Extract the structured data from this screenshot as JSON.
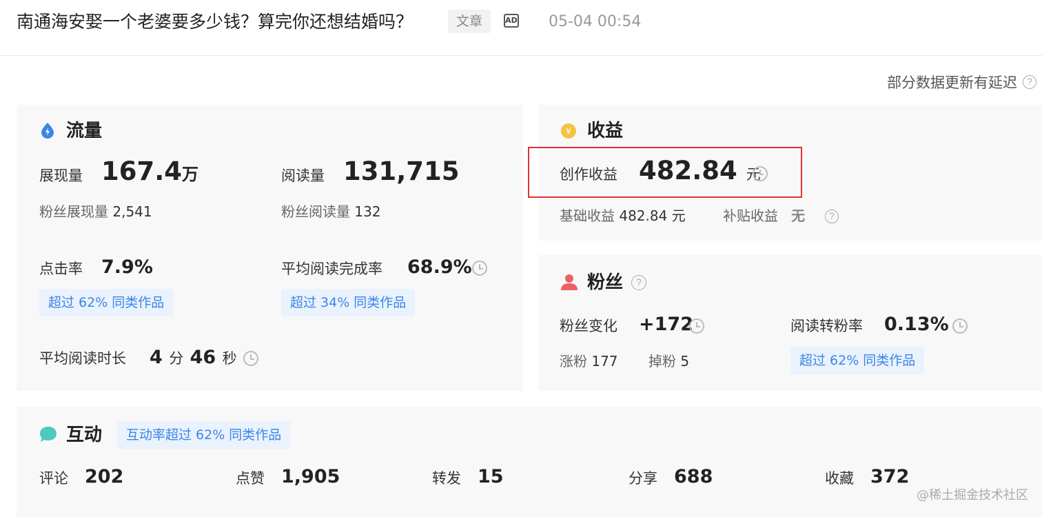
{
  "header": {
    "title": "南通海安娶一个老婆要多少钱？算完你还想结婚吗？",
    "type_tag": "文章",
    "ad_icon_label": "AD",
    "publish_time": "05-04 00:54"
  },
  "delay_note": "部分数据更新有延迟",
  "traffic": {
    "title": "流量",
    "impressions_label": "展现量",
    "impressions_value": "167.4",
    "impressions_unit": "万",
    "reads_label": "阅读量",
    "reads_value": "131,715",
    "fan_impressions_label": "粉丝展现量",
    "fan_impressions_value": "2,541",
    "fan_reads_label": "粉丝阅读量",
    "fan_reads_value": "132",
    "ctr_label": "点击率",
    "ctr_value": "7.9%",
    "ctr_badge": "超过 62% 同类作品",
    "completion_label": "平均阅读完成率",
    "completion_value": "68.9%",
    "completion_badge": "超过 34% 同类作品",
    "duration_label": "平均阅读时长",
    "duration_min": "4",
    "duration_min_unit": "分",
    "duration_sec": "46",
    "duration_sec_unit": "秒"
  },
  "revenue": {
    "title": "收益",
    "creation_label": "创作收益",
    "creation_value": "482.84",
    "creation_unit": "元",
    "base_label": "基础收益",
    "base_value": "482.84 元",
    "subsidy_label": "补贴收益",
    "subsidy_value": "无"
  },
  "fans": {
    "title": "粉丝",
    "change_label": "粉丝变化",
    "change_value": "+172",
    "conversion_label": "阅读转粉率",
    "conversion_value": "0.13%",
    "gain_label": "涨粉",
    "gain_value": "177",
    "loss_label": "掉粉",
    "loss_value": "5",
    "conversion_badge": "超过 62% 同类作品"
  },
  "interaction": {
    "title": "互动",
    "badge": "互动率超过 62% 同类作品",
    "stats": [
      {
        "label": "评论",
        "value": "202"
      },
      {
        "label": "点赞",
        "value": "1,905"
      },
      {
        "label": "转发",
        "value": "15"
      },
      {
        "label": "分享",
        "value": "688"
      },
      {
        "label": "收藏",
        "value": "372"
      }
    ]
  },
  "watermark": "@稀土掘金技术社区",
  "colors": {
    "badge_text": "#3a86e6",
    "badge_bg": "#eaf2fd",
    "highlight": "#e23030",
    "traffic_icon": "#3a86e6",
    "revenue_icon": "#f5c242",
    "fans_icon": "#f06060",
    "interaction_icon": "#4fc8c0"
  }
}
